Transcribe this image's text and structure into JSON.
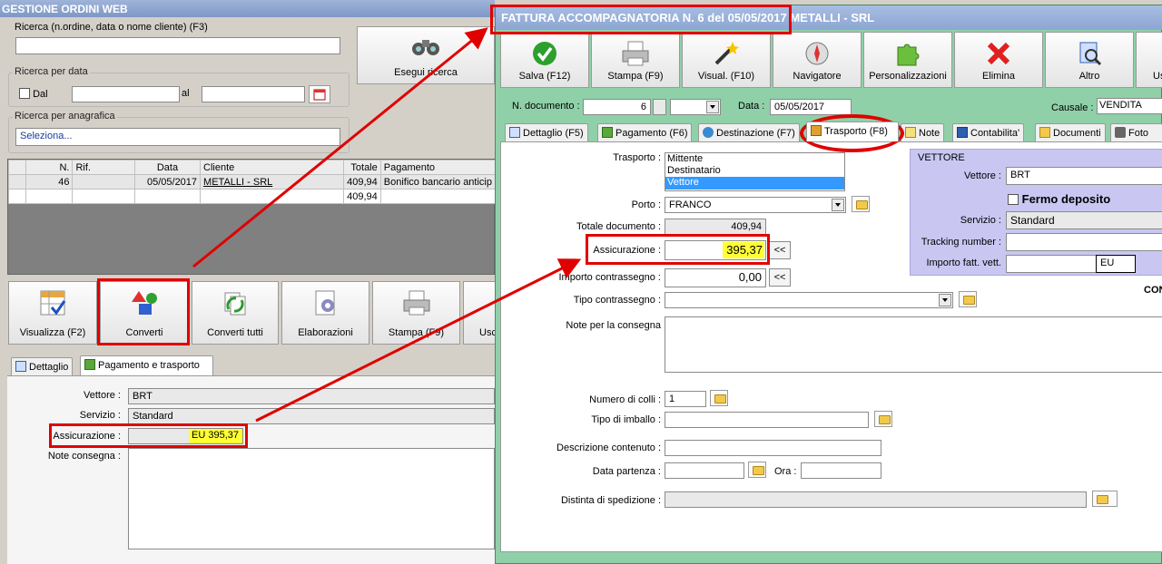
{
  "back": {
    "title": "GESTIONE ORDINI WEB",
    "search_label": "Ricerca (n.ordine, data o nome cliente) (F3)",
    "search_value": "",
    "date_group": "Ricerca per data",
    "dal_label": "Dal",
    "al_label": "al",
    "anag_group": "Ricerca per anagrafica",
    "anag_value": "Seleziona...",
    "search_button": "Esegui ricerca",
    "table": {
      "headers": [
        "N.",
        "Rif.",
        "Data",
        "Cliente",
        "Totale",
        "Pagamento"
      ],
      "rows": [
        [
          "46",
          "",
          "05/05/2017",
          "METALLI - SRL",
          "409,94",
          "Bonifico bancario anticip"
        ],
        [
          "",
          "",
          "",
          "",
          "409,94",
          ""
        ]
      ]
    },
    "toolbar": [
      "Visualizza (F2)",
      "Converti",
      "Converti tutti",
      "Elaborazioni",
      "Stampa (F9)",
      "Usc"
    ],
    "tabs": [
      "Dettaglio",
      "Pagamento e trasporto"
    ],
    "vettore_label": "Vettore :",
    "vettore_value": "BRT",
    "servizio_label": "Servizio :",
    "servizio_value": "Standard",
    "assic_label": "Assicurazione :",
    "assic_value": "EU 395,37",
    "note_label": "Note consegna :"
  },
  "front": {
    "title": "FATTURA ACCOMPAGNATORIA N. 6 del 05/05/2017  METALLI - SRL",
    "toolbar": [
      "Salva (F12)",
      "Stampa (F9)",
      "Visual. (F10)",
      "Navigatore",
      "Personalizzazioni",
      "Elimina",
      "Altro",
      "Us"
    ],
    "ndoc_label": "N. documento :",
    "ndoc_value": "6",
    "data_label": "Data :",
    "data_value": "05/05/2017",
    "causale_label": "Causale :",
    "causale_value": "VENDITA",
    "tabs": [
      "Dettaglio (F5)",
      "Pagamento (F6)",
      "Destinazione (F7)",
      "Trasporto (F8)",
      "Note",
      "Contabilita'",
      "Documenti",
      "Foto"
    ],
    "trasporto_label": "Trasporto :",
    "trasporto_options": [
      "Mittente",
      "Destinatario",
      "Vettore"
    ],
    "porto_label": "Porto :",
    "porto_value": "FRANCO",
    "totale_label": "Totale documento :",
    "totale_value": "409,94",
    "assic_label": "Assicurazione :",
    "assic_value": "395,37",
    "contrassegno_label": "Importo contrassegno :",
    "contrassegno_value": "0,00",
    "tipo_contr_label": "Tipo contrassegno :",
    "note_label": "Note per la consegna",
    "colli_label": "Numero di colli :",
    "colli_value": "1",
    "imballo_label": "Tipo di imballo :",
    "descr_label": "Descrizione contenuto :",
    "partenza_label": "Data partenza :",
    "ora_label": "Ora :",
    "distinta_label": "Distinta di spedizione :",
    "vettore_box": {
      "title": "VETTORE",
      "vettore_label": "Vettore :",
      "vettore_value": "BRT",
      "fermo_label": "Fermo deposito",
      "servizio_label": "Servizio :",
      "servizio_value": "Standard",
      "tracking_label": "Tracking number :",
      "importo_label": "Importo fatt. vett.",
      "importo_cur": "EU"
    },
    "con_label": "CON",
    "btn_arrow": "<<"
  }
}
